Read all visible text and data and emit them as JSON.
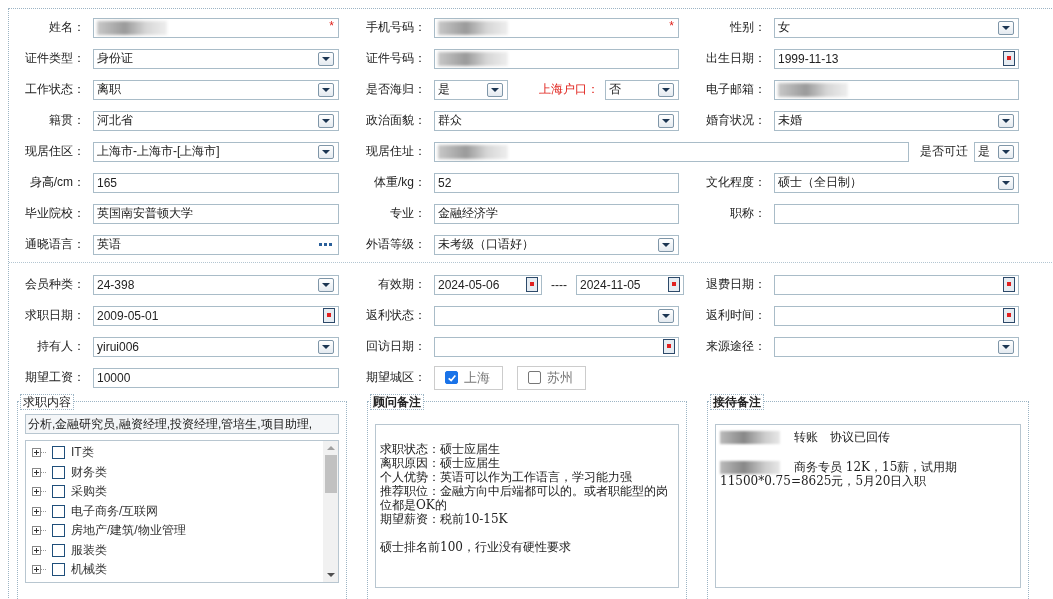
{
  "sections": [
    {
      "rows": [
        {
          "kind": "normal",
          "cells": [
            {
              "label": "姓名：",
              "kind": "redacted",
              "required": "*"
            },
            {
              "label": "手机号码：",
              "kind": "redacted",
              "required": "*"
            },
            {
              "label": "性别：",
              "kind": "select",
              "value": "女"
            }
          ]
        },
        {
          "kind": "normal",
          "cells": [
            {
              "label": "证件类型：",
              "kind": "select",
              "value": "身份证"
            },
            {
              "label": "证件号码：",
              "kind": "redacted"
            },
            {
              "label": "出生日期：",
              "kind": "date",
              "value": "1999-11-13"
            }
          ]
        },
        {
          "kind": "normal",
          "cells": [
            {
              "label": "工作状态：",
              "kind": "select",
              "value": "离职"
            },
            {
              "label": "是否海归：",
              "kind": "split",
              "value": "是",
              "extra_label": "上海户口：",
              "extra_value": "否"
            },
            {
              "label": "电子邮箱：",
              "kind": "redacted"
            }
          ]
        },
        {
          "kind": "normal",
          "cells": [
            {
              "label": "籍贯：",
              "kind": "select",
              "value": "河北省"
            },
            {
              "label": "政治面貌：",
              "kind": "select",
              "value": "群众"
            },
            {
              "label": "婚育状况：",
              "kind": "select",
              "value": "未婚"
            }
          ]
        },
        {
          "kind": "wide",
          "cells": [
            {
              "label": "现居住区：",
              "kind": "select",
              "value": " 上海市-上海市-[上海市]"
            },
            {
              "label": "现居住址：",
              "kind": "redacted"
            },
            {
              "label": "是否可迁",
              "kind": "select",
              "value": "是"
            }
          ]
        },
        {
          "kind": "normal",
          "cells": [
            {
              "label": "身高/cm：",
              "kind": "text",
              "value": "165"
            },
            {
              "label": "体重/kg：",
              "kind": "text",
              "value": "52"
            },
            {
              "label": "文化程度：",
              "kind": "select",
              "value": "硕士（全日制）"
            }
          ]
        },
        {
          "kind": "normal",
          "cells": [
            {
              "label": "毕业院校：",
              "kind": "text",
              "value": "英国南安普顿大学"
            },
            {
              "label": "专业：",
              "kind": "text",
              "value": "金融经济学"
            },
            {
              "label": "职称：",
              "kind": "text"
            }
          ]
        },
        {
          "kind": "normal",
          "cells": [
            {
              "label": "通晓语言：",
              "kind": "more",
              "value": "英语"
            },
            {
              "label": "外语等级：",
              "kind": "select",
              "value": "未考级（口语好）"
            }
          ]
        }
      ]
    },
    {
      "rows": [
        {
          "kind": "normal",
          "cells": [
            {
              "label": "会员种类：",
              "kind": "select",
              "value": " 24-398"
            },
            {
              "label": "有效期：",
              "kind": "date_range",
              "values": [
                "2024-05-06",
                "2024-11-05"
              ],
              "separator": "----"
            },
            {
              "label": "退费日期：",
              "kind": "date"
            }
          ]
        },
        {
          "kind": "normal",
          "cells": [
            {
              "label": "求职日期：",
              "kind": "date",
              "value": "2009-05-01"
            },
            {
              "label": "返利状态：",
              "kind": "select"
            },
            {
              "label": "返利时间：",
              "kind": "date"
            }
          ]
        },
        {
          "kind": "normal",
          "cells": [
            {
              "label": "持有人：",
              "kind": "select",
              "value": "yirui006"
            },
            {
              "label": "回访日期：",
              "kind": "date"
            },
            {
              "label": "来源途径：",
              "kind": "select"
            }
          ]
        },
        {
          "kind": "normal",
          "cells": [
            {
              "label": "期望工资：",
              "kind": "text",
              "value": "10000"
            },
            {
              "label": "期望城区：",
              "kind": "checks",
              "options": [
                {
                  "label": "上海",
                  "checked": true
                },
                {
                  "label": "苏州",
                  "checked": false
                }
              ]
            }
          ]
        }
      ]
    }
  ],
  "panels": [
    {
      "title": "求职内容",
      "kind": "tree",
      "input_value": "分析,金融研究员,融资经理,投资经理,管培生,项目助理,",
      "items": [
        {
          "label": "IT类",
          "checked": false,
          "expanded": false
        },
        {
          "label": "财务类",
          "checked": false,
          "expanded": false
        },
        {
          "label": "采购类",
          "checked": false,
          "expanded": false
        },
        {
          "label": "电子商务/互联网",
          "checked": false,
          "expanded": false
        },
        {
          "label": "房地产/建筑/物业管理",
          "checked": false,
          "expanded": false
        },
        {
          "label": "服装类",
          "checked": false,
          "expanded": false
        },
        {
          "label": "机械类",
          "checked": false,
          "expanded": false
        }
      ]
    },
    {
      "title": "顾问备注",
      "kind": "notes",
      "lines": [
        {
          "kind": "blank"
        },
        {
          "kind": "text",
          "text": "求职状态：硕士应届生"
        },
        {
          "kind": "text",
          "text": "离职原因：硕士应届生"
        },
        {
          "kind": "text",
          "text": "个人优势：英语可以作为工作语言，学习能力强"
        },
        {
          "kind": "text",
          "text": "推荐职位：金融方向中后端都可以的。或者职能型的岗位都是OK的"
        },
        {
          "kind": "text",
          "text": "期望薪资：税前10-15K"
        },
        {
          "kind": "blank"
        },
        {
          "kind": "text",
          "text": "硕士排名前100，行业没有硬性要求"
        }
      ]
    },
    {
      "title": "接待备注",
      "kind": "notes",
      "lines": [
        {
          "kind": "redacted",
          "text": "转账　协议已回传"
        },
        {
          "kind": "blank"
        },
        {
          "kind": "redacted",
          "text": "商务专员 12K，15薪，试用期"
        },
        {
          "kind": "text",
          "text": "11500*0.75=8625元，5月20日入职"
        }
      ]
    }
  ]
}
